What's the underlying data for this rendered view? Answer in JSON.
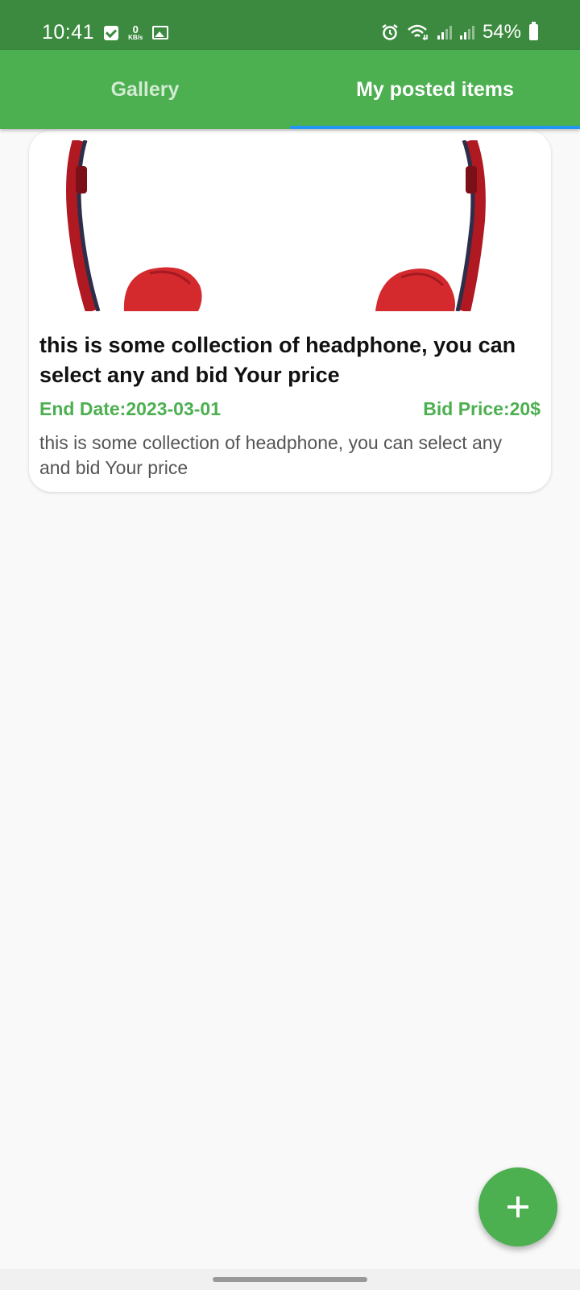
{
  "status_bar": {
    "time": "10:41",
    "net_speed_value": "0",
    "net_speed_unit": "KB/s",
    "battery": "54%",
    "icons": [
      "check-icon",
      "image-icon",
      "alarm-icon",
      "wifi-icon",
      "signal-icon",
      "battery-icon"
    ]
  },
  "tabs": [
    {
      "label": "Gallery",
      "active": false
    },
    {
      "label": "My posted items",
      "active": true
    }
  ],
  "items": [
    {
      "title": "this is some collection of headphone, you can select any and bid Your price",
      "end_date": "End Date:2023-03-01",
      "bid_price": "Bid Price:20$",
      "description": "this is some collection of headphone, you can select any and bid Your price",
      "image": "red-headphones"
    }
  ],
  "fab": {
    "icon": "plus-icon"
  },
  "colors": {
    "status_bar": "#3c8a3f",
    "primary": "#4caf50",
    "tab_indicator": "#2196f3",
    "background": "#f9f9f9"
  }
}
